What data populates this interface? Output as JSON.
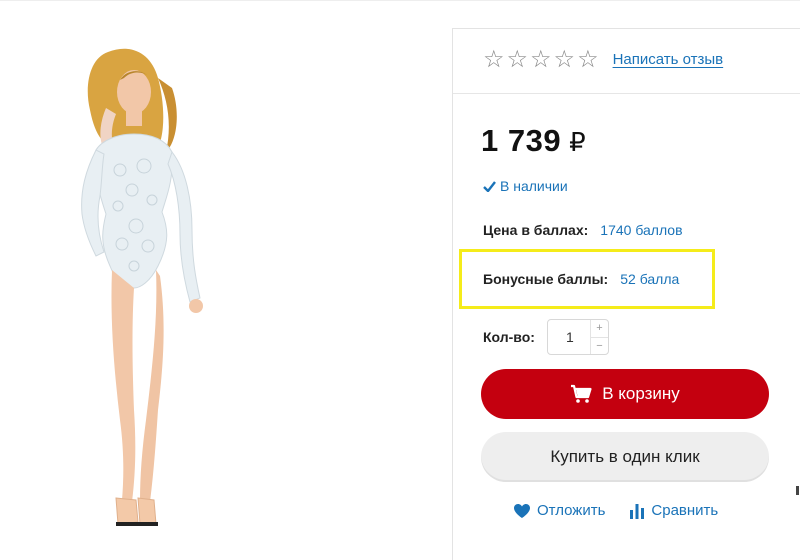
{
  "product": {
    "image_alt": "",
    "rating": {
      "stars": [
        "☆",
        "☆",
        "☆",
        "☆",
        "☆"
      ],
      "review_link": "Написать отзыв"
    },
    "price": {
      "value": "1 739",
      "currency": "₽"
    },
    "stock": {
      "icon": "check-icon",
      "text": "В наличии"
    },
    "points_price": {
      "label": "Цена в баллах:",
      "value": "1740 баллов"
    },
    "bonus": {
      "label": "Бонусные баллы:",
      "value": "52 балла"
    },
    "quantity": {
      "label": "Кол-во:",
      "value": "1",
      "plus": "+",
      "minus": "−"
    },
    "buttons": {
      "cart": "В корзину",
      "one_click": "Купить в один клик"
    },
    "actions": {
      "defer": "Отложить",
      "compare": "Сравнить"
    }
  },
  "colors": {
    "accent_red": "#c4000f",
    "link_blue": "#1a73b8",
    "highlight_yellow": "#f5ec1a"
  }
}
